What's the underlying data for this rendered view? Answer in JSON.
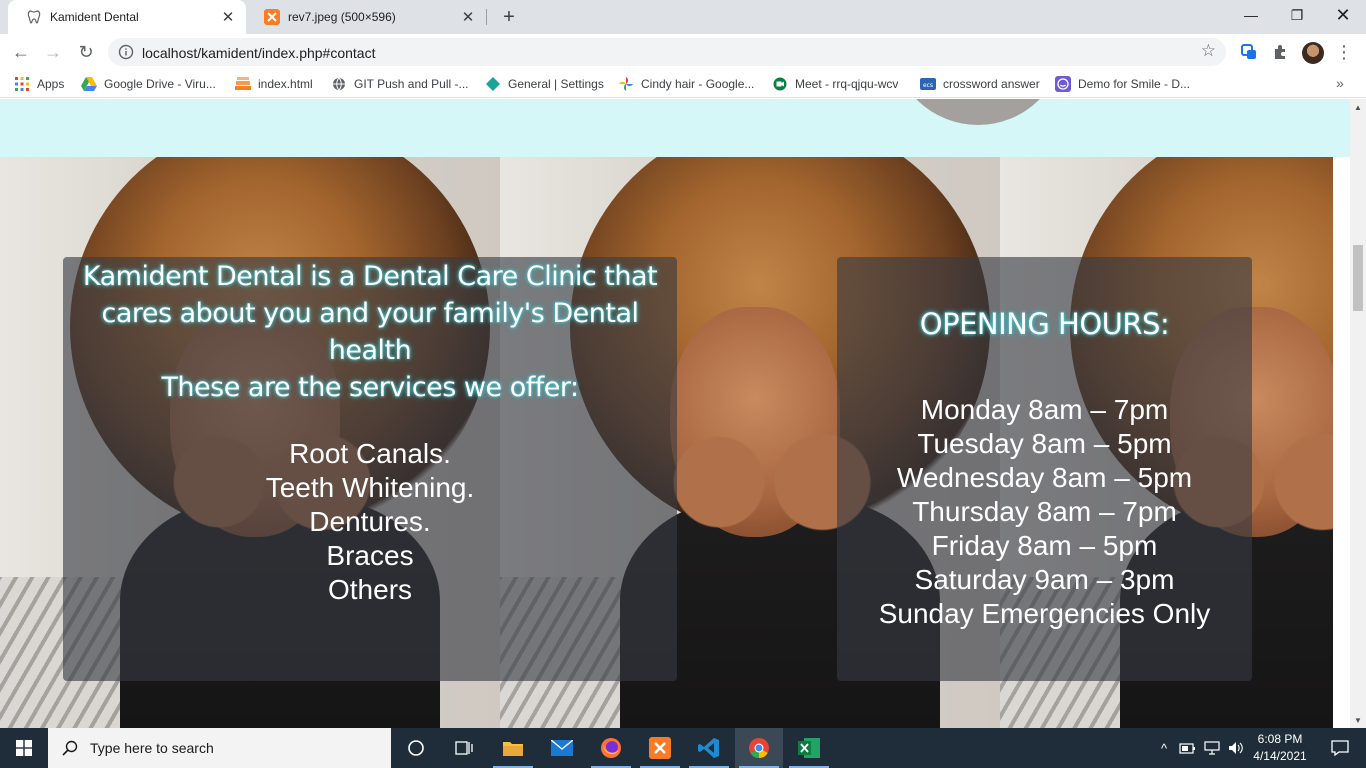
{
  "browser": {
    "tabs": [
      {
        "title": "Kamident Dental",
        "active": true,
        "icon": "tooth-icon"
      },
      {
        "title": "rev7.jpeg (500×596)",
        "active": false,
        "icon": "xampp-icon"
      }
    ],
    "url": "localhost/kamident/index.php#contact",
    "bookmarks": [
      {
        "label": "Apps",
        "icon": "apps-grid-icon"
      },
      {
        "label": "Google Drive - Viru...",
        "icon": "google-drive-icon"
      },
      {
        "label": "index.html",
        "icon": "stack-icon"
      },
      {
        "label": "GIT Push and Pull -...",
        "icon": "globe-icon"
      },
      {
        "label": "General | Settings",
        "icon": "diamond-icon"
      },
      {
        "label": "Cindy hair - Google...",
        "icon": "google-photos-icon"
      },
      {
        "label": "Meet - rrq-qjqu-wcv",
        "icon": "meet-icon"
      },
      {
        "label": "crossword answer",
        "icon": "ecs-icon"
      },
      {
        "label": "Demo for Smile - D...",
        "icon": "smile-icon"
      }
    ]
  },
  "page": {
    "intro_line1": "Kamident Dental is a Dental Care Clinic that cares about you and your family's Dental health",
    "intro_line2": "These are the services we offer:",
    "services": [
      "Root Canals.",
      "Teeth Whitening.",
      "Dentures.",
      "Braces",
      "Others"
    ],
    "hours_title": "OPENING HOURS:",
    "hours": [
      "Monday 8am – 7pm",
      "Tuesday 8am – 5pm",
      "Wednesday 8am – 5pm",
      "Thursday 8am – 7pm",
      "Friday 8am – 5pm",
      "Saturday 9am – 3pm",
      "Sunday Emergencies Only"
    ],
    "colors": {
      "teal_band": "#d6f7f7",
      "panel": "rgba(55,58,66,0.62)",
      "glow": "#22aebb"
    }
  },
  "taskbar": {
    "search_placeholder": "Type here to search",
    "time": "6:08 PM",
    "date": "4/14/2021",
    "apps": [
      "task-view-icon",
      "file-explorer-icon",
      "mail-icon",
      "firefox-icon",
      "xampp-icon",
      "vscode-icon",
      "chrome-icon",
      "excel-icon"
    ]
  }
}
